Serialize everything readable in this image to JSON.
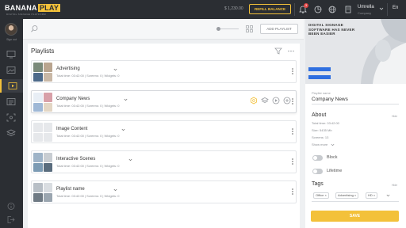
{
  "brand": {
    "name_a": "BANANA",
    "name_b": "PLAY",
    "tagline": "DIGITAL SIGNAGE PLATFORM",
    "accent": "#f3c13a"
  },
  "header": {
    "balance": "$ 1,230.00",
    "refill_label": "REFILL BALANCE",
    "notifications_count": "3",
    "user_name": "Umrella",
    "user_company": "Company",
    "language": "En"
  },
  "sidebar": {
    "signout_label": "Sign out"
  },
  "toolbar": {
    "add_playlist_label": "ADD PLAYLIST"
  },
  "playlists": {
    "title": "Playlists",
    "items": [
      {
        "name": "Advertising",
        "meta": "Total time: 03:42:00  |  Screens: 0  |  Widgets: 0"
      },
      {
        "name": "Company News",
        "meta": "Total time: 03:42:00  |  Screens: 0  |  Widgets: 0"
      },
      {
        "name": "Image Content",
        "meta": "Total time: 03:42:00  |  Screens: 0  |  Widgets: 0"
      },
      {
        "name": "Interactive Scenes",
        "meta": "Total time: 03:42:00  |  Screens: 0  |  Widgets: 0"
      },
      {
        "name": "Playlist name",
        "meta": "Total time: 03:42:00  |  Screens: 0  |  Widgets: 0"
      }
    ]
  },
  "details": {
    "preview_text": "DIGITAL SIGNAGE SOFTWARE HAS NEVER BEEN EASIER",
    "name_label": "Playlist name",
    "name_value": "Company News",
    "about_title": "About",
    "hide_label": "Hide",
    "total_time": "Total time: 03:42:00",
    "size": "Size: 5435 Mb",
    "screens": "Screens: 13",
    "show_more": "Show more",
    "block_label": "Block",
    "lifetime_label": "Lifetime",
    "tags_title": "Tags",
    "tags": [
      "Office",
      "Advertising",
      "HD"
    ],
    "save_label": "SAVE"
  }
}
